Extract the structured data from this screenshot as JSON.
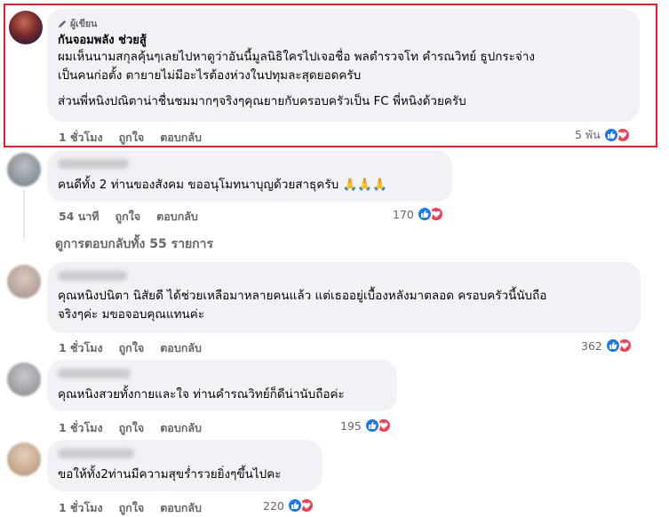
{
  "comments": [
    {
      "badge": "ผู้เขียน",
      "author": "กันจอมพลัง ช่วยสู้",
      "lines": [
        "ผมเห็นนามสกุลคุ้นๆเลยไปหาดูว่าอันนี้มูลนิธิใครไปเจอชื่อ พลตำรวจโท คำรณวิทย์ ธูปกระจ่าง",
        "เป็นคนก่อตั้ง ตายายไม่มีอะไรต้องห่วงในปทุมละสุดยอดครับ",
        "ส่วนพี่หนิงปณิตาน่าชื่นชมมากๆจริงๆคุณยายกับครอบครัวเป็น FC พี่หนิงด้วยครับ"
      ],
      "time": "1 ชั่วโมง",
      "like": "ถูกใจ",
      "reply": "ตอบกลับ",
      "reactions": "5 พัน"
    },
    {
      "lines": [
        "คนดีทั้ง 2 ท่านของสังคม ขออนุโมทนาบุญด้วยสาธุครับ 🙏🙏🙏"
      ],
      "time": "54 นาที",
      "like": "ถูกใจ",
      "reply": "ตอบกลับ",
      "reactions": "170"
    },
    {
      "lines": [
        "คุณหนิงปนิตา นิสัยดี ได้ช่วยเหลือมาหลายคนแล้ว แต่เธออยู่เบื้องหลังมาตลอด ครอบครัวนี้นับถือ",
        "จริงๆค่ะ มขอจอบคุณแทนค่ะ"
      ],
      "time": "1 ชั่วโมง",
      "like": "ถูกใจ",
      "reply": "ตอบกลับ",
      "reactions": "362"
    },
    {
      "lines": [
        "คุณหนิงสวยทั้งกายและใจ ท่านคำรณวิทย์ก็ดีน่านับถือค่ะ"
      ],
      "time": "1 ชั่วโมง",
      "like": "ถูกใจ",
      "reply": "ตอบกลับ",
      "reactions": "195"
    },
    {
      "lines": [
        "ขอให้ทั้ง2ท่านมีความสุขร่ำรวยยิ่งๆขึ้นไปคะ"
      ],
      "time": "1 ชั่วโมง",
      "like": "ถูกใจ",
      "reply": "ตอบกลับ",
      "reactions": "220"
    }
  ],
  "view_replies": "ดูการตอบกลับทั้ง 55 รายการ",
  "icons": {
    "author_badge": "pen-icon",
    "like_reaction": "thumbs-up-icon",
    "love_reaction": "heart-icon"
  },
  "colors": {
    "highlight": "#e0202a",
    "like": "#1877f2",
    "love": "#f33e58",
    "bubble": "#f0f2f5",
    "meta_text": "#65676b"
  }
}
